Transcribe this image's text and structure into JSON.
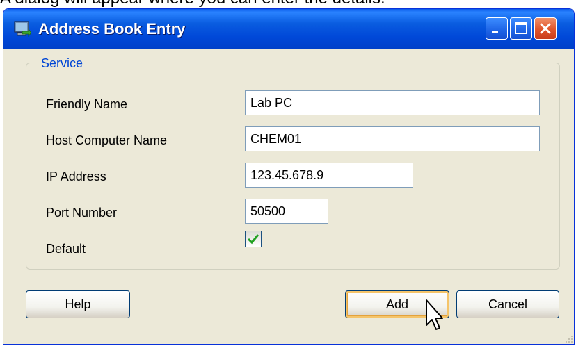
{
  "background": {
    "partial_text": "A dialog will appear where you can enter the details."
  },
  "window": {
    "title": "Address Book Entry",
    "icon": "network-computer-icon",
    "controls": [
      "minimize-icon",
      "maximize-icon",
      "close-icon"
    ]
  },
  "service_group": {
    "legend": "Service",
    "fields": {
      "friendly_name": {
        "label": "Friendly Name",
        "value": "Lab PC"
      },
      "host_computer_name": {
        "label": "Host Computer Name",
        "value": "CHEM01"
      },
      "ip_address": {
        "label": "IP Address",
        "value": "123.45.678.9"
      },
      "port_number": {
        "label": "Port Number",
        "value": "50500"
      },
      "default": {
        "label": "Default",
        "checked": true
      }
    }
  },
  "buttons": {
    "help": "Help",
    "add": "Add",
    "cancel": "Cancel"
  },
  "colors": {
    "title_bar": "#0a5de0",
    "dialog_bg": "#ece9d8",
    "legend": "#0046d5",
    "check": "#21a121"
  }
}
